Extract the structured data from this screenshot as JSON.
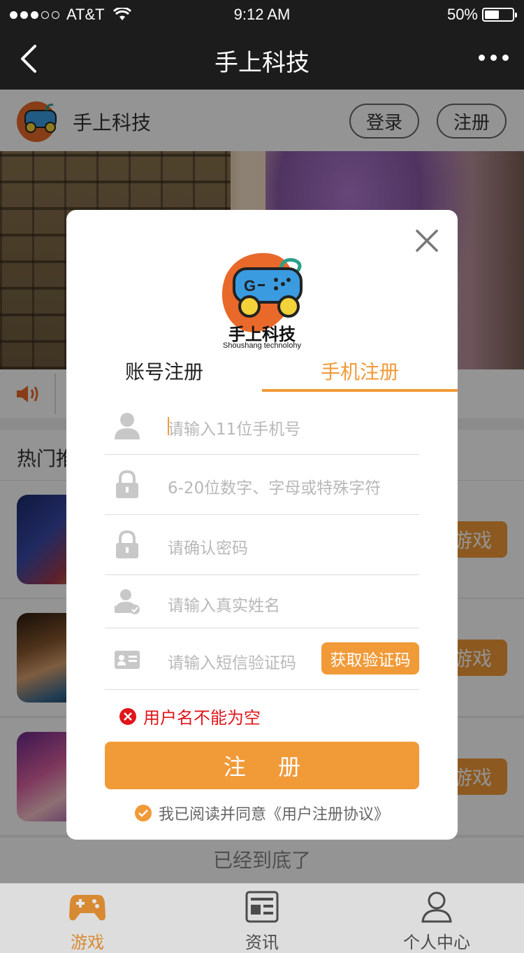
{
  "status_bar": {
    "carrier": "AT&T",
    "time": "9:12 AM",
    "battery": "50%"
  },
  "navbar": {
    "title": "手上科技"
  },
  "page_header": {
    "brand": "手上科技",
    "login_label": "登录",
    "register_label": "注册"
  },
  "hot_section": {
    "label": "热门推"
  },
  "games": [
    {
      "play_label": "游戏"
    },
    {
      "play_label": "游戏"
    },
    {
      "play_label": "游戏"
    }
  ],
  "bottom_note": "已经到底了",
  "tabbar": {
    "items": [
      {
        "label": "游戏",
        "icon": "gamepad-icon",
        "active": true
      },
      {
        "label": "资讯",
        "icon": "news-icon",
        "active": false
      },
      {
        "label": "个人中心",
        "icon": "person-icon",
        "active": false
      }
    ]
  },
  "modal": {
    "logo_text": "手上科技",
    "logo_subtext": "Shoushang technolohy",
    "tabs": [
      {
        "label": "账号注册",
        "active": false
      },
      {
        "label": "手机注册",
        "active": true
      }
    ],
    "fields": {
      "phone_placeholder": "请输入11位手机号",
      "password_placeholder": "6-20位数字、字母或特殊字符",
      "confirm_placeholder": "请确认密码",
      "realname_placeholder": "请输入真实姓名",
      "sms_placeholder": "请输入短信验证码"
    },
    "sms_button": "获取验证码",
    "error": "用户名不能为空",
    "submit_label": "注 册",
    "agreement": "我已阅读并同意《用户注册协议》"
  },
  "colors": {
    "accent": "#f19a38",
    "error": "#e0161c",
    "dark_bar": "#1c1c1c"
  }
}
